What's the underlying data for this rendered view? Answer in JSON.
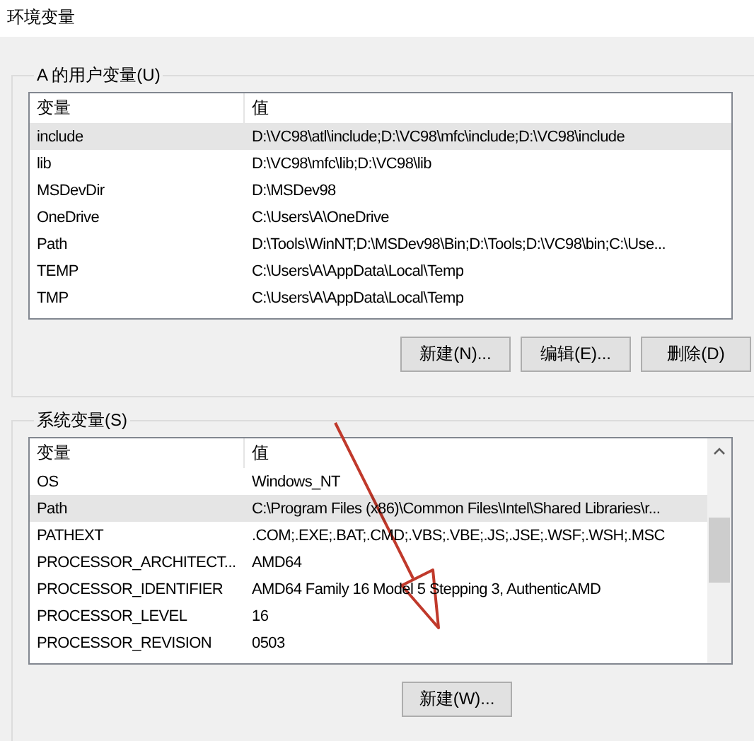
{
  "window": {
    "title": "环境变量"
  },
  "user_variables": {
    "label": "A 的用户变量(U)",
    "columns": [
      "变量",
      "值"
    ],
    "rows": [
      {
        "name": "include",
        "value": "D:\\VC98\\atl\\include;D:\\VC98\\mfc\\include;D:\\VC98\\include",
        "selected": true
      },
      {
        "name": "lib",
        "value": "D:\\VC98\\mfc\\lib;D:\\VC98\\lib",
        "selected": false
      },
      {
        "name": "MSDevDir",
        "value": "D:\\MSDev98",
        "selected": false
      },
      {
        "name": "OneDrive",
        "value": "C:\\Users\\A\\OneDrive",
        "selected": false
      },
      {
        "name": "Path",
        "value": "D:\\Tools\\WinNT;D:\\MSDev98\\Bin;D:\\Tools;D:\\VC98\\bin;C:\\Use...",
        "selected": false
      },
      {
        "name": "TEMP",
        "value": "C:\\Users\\A\\AppData\\Local\\Temp",
        "selected": false
      },
      {
        "name": "TMP",
        "value": "C:\\Users\\A\\AppData\\Local\\Temp",
        "selected": false
      }
    ],
    "buttons": [
      "新建(N)...",
      "编辑(E)...",
      "删除(D)"
    ]
  },
  "system_variables": {
    "label": "系统变量(S)",
    "columns": [
      "变量",
      "值"
    ],
    "rows": [
      {
        "name": "OS",
        "value": "Windows_NT",
        "selected": false
      },
      {
        "name": "Path",
        "value": "C:\\Program Files (x86)\\Common Files\\Intel\\Shared Libraries\\r...",
        "selected": true
      },
      {
        "name": "PATHEXT",
        "value": ".COM;.EXE;.BAT;.CMD;.VBS;.VBE;.JS;.JSE;.WSF;.WSH;.MSC",
        "selected": false
      },
      {
        "name": "PROCESSOR_ARCHITECT...",
        "value": "AMD64",
        "selected": false
      },
      {
        "name": "PROCESSOR_IDENTIFIER",
        "value": "AMD64 Family 16 Model 5 Stepping 3, AuthenticAMD",
        "selected": false
      },
      {
        "name": "PROCESSOR_LEVEL",
        "value": "16",
        "selected": false
      },
      {
        "name": "PROCESSOR_REVISION",
        "value": "0503",
        "selected": false
      }
    ],
    "buttons": [
      "新建(W)..."
    ]
  },
  "annotation": {
    "kind": "arrow"
  }
}
